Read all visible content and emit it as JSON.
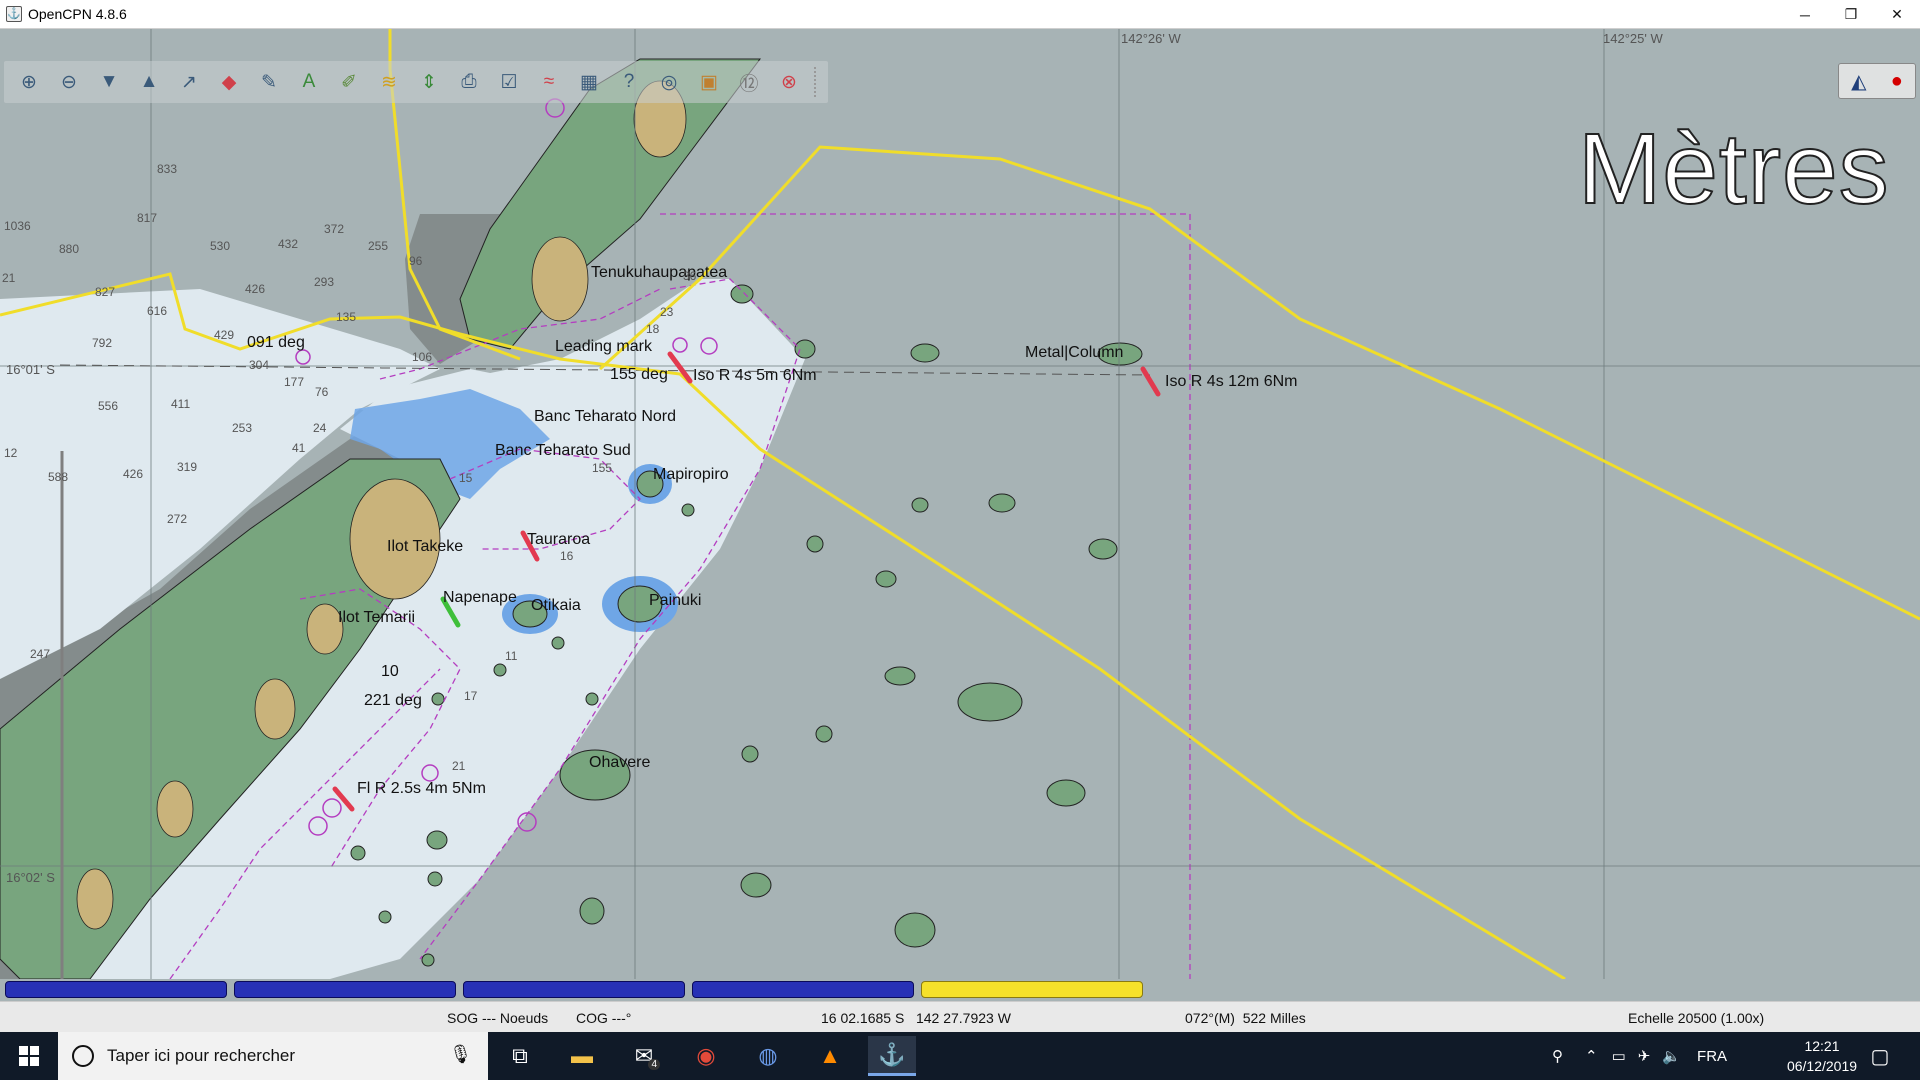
{
  "window": {
    "title": "OpenCPN 4.8.6",
    "minimize_glyph": "─",
    "maximize_glyph": "❐",
    "close_glyph": "✕"
  },
  "toolbar": {
    "icons": [
      "zoom-in-icon",
      "zoom-out-icon",
      "scale-in-icon",
      "scale-out-icon",
      "route-icon",
      "ais-icon",
      "measure-icon",
      "text-icon",
      "mark-icon",
      "track-icon",
      "follow-icon",
      "print-icon",
      "route-manager-icon",
      "tide-icon",
      "current-icon",
      "settings-icon",
      "help-icon",
      "globe-icon",
      "chart-icon",
      "scale-icon",
      "mob-icon"
    ]
  },
  "map": {
    "units_overlay": "Mètres",
    "top_longitude_labels": [
      "142°26' W",
      "142°25' W"
    ],
    "left_latitude_labels": [
      "16°01' S",
      "16°02' S"
    ],
    "place_labels": [
      "Tenukuhaupapatea",
      "Leading mark",
      "091 deg",
      "155 deg",
      "Iso R 4s 5m 6Nm",
      "Metal|Column",
      "Iso R 4s 12m 6Nm",
      "Banc Teharato Nord",
      "Banc Teharato Sud",
      "Mapiropiro",
      "Ilot Takeke",
      "Tauraroa",
      "Ilot Temarii",
      "Napenape",
      "Otikaia",
      "Painuki",
      "10",
      "221 deg",
      "Ohavere",
      "Fl R 2.5s 4m 5Nm"
    ],
    "soundings": [
      "833",
      "817",
      "1036",
      "880",
      "530",
      "432",
      "372",
      "255",
      "21",
      "827",
      "616",
      "426",
      "293",
      "135",
      "792",
      "429",
      "304",
      "177",
      "106",
      "76",
      "556",
      "411",
      "253",
      "24",
      "41",
      "12",
      "588",
      "426",
      "319",
      "272",
      "247",
      "96",
      "36",
      "23",
      "18",
      "155",
      "16",
      "11",
      "15",
      "21",
      "17"
    ]
  },
  "piano": {
    "keys": [
      "chart-1",
      "chart-2",
      "chart-3",
      "chart-4",
      "chart-5"
    ],
    "colors": {
      "inactive": "#2731b6",
      "active": "#f6e12a"
    }
  },
  "statusbar": {
    "sog": "SOG --- Noeuds",
    "cog": "COG ---°",
    "position": "16 02.1685 S   142 27.7923 W",
    "bearing_distance": "072°(M)  522 Milles",
    "scale": "Echelle 20500 (1.00x)"
  },
  "taskbar": {
    "search_placeholder": "Taper ici pour rechercher",
    "mail_badge": "4",
    "language": "FRA",
    "time": "12:21",
    "date": "06/12/2019"
  },
  "colors": {
    "deep_water": "#a7b3b5",
    "shallow_water": "#dfe9ef",
    "very_shallow": "#6fa6e6",
    "land": "#78a57e",
    "sand": "#c9b37b",
    "dark_land": "#848c8c",
    "track_yellow": "#f0dd2a",
    "magenta": "#b43dc0"
  }
}
